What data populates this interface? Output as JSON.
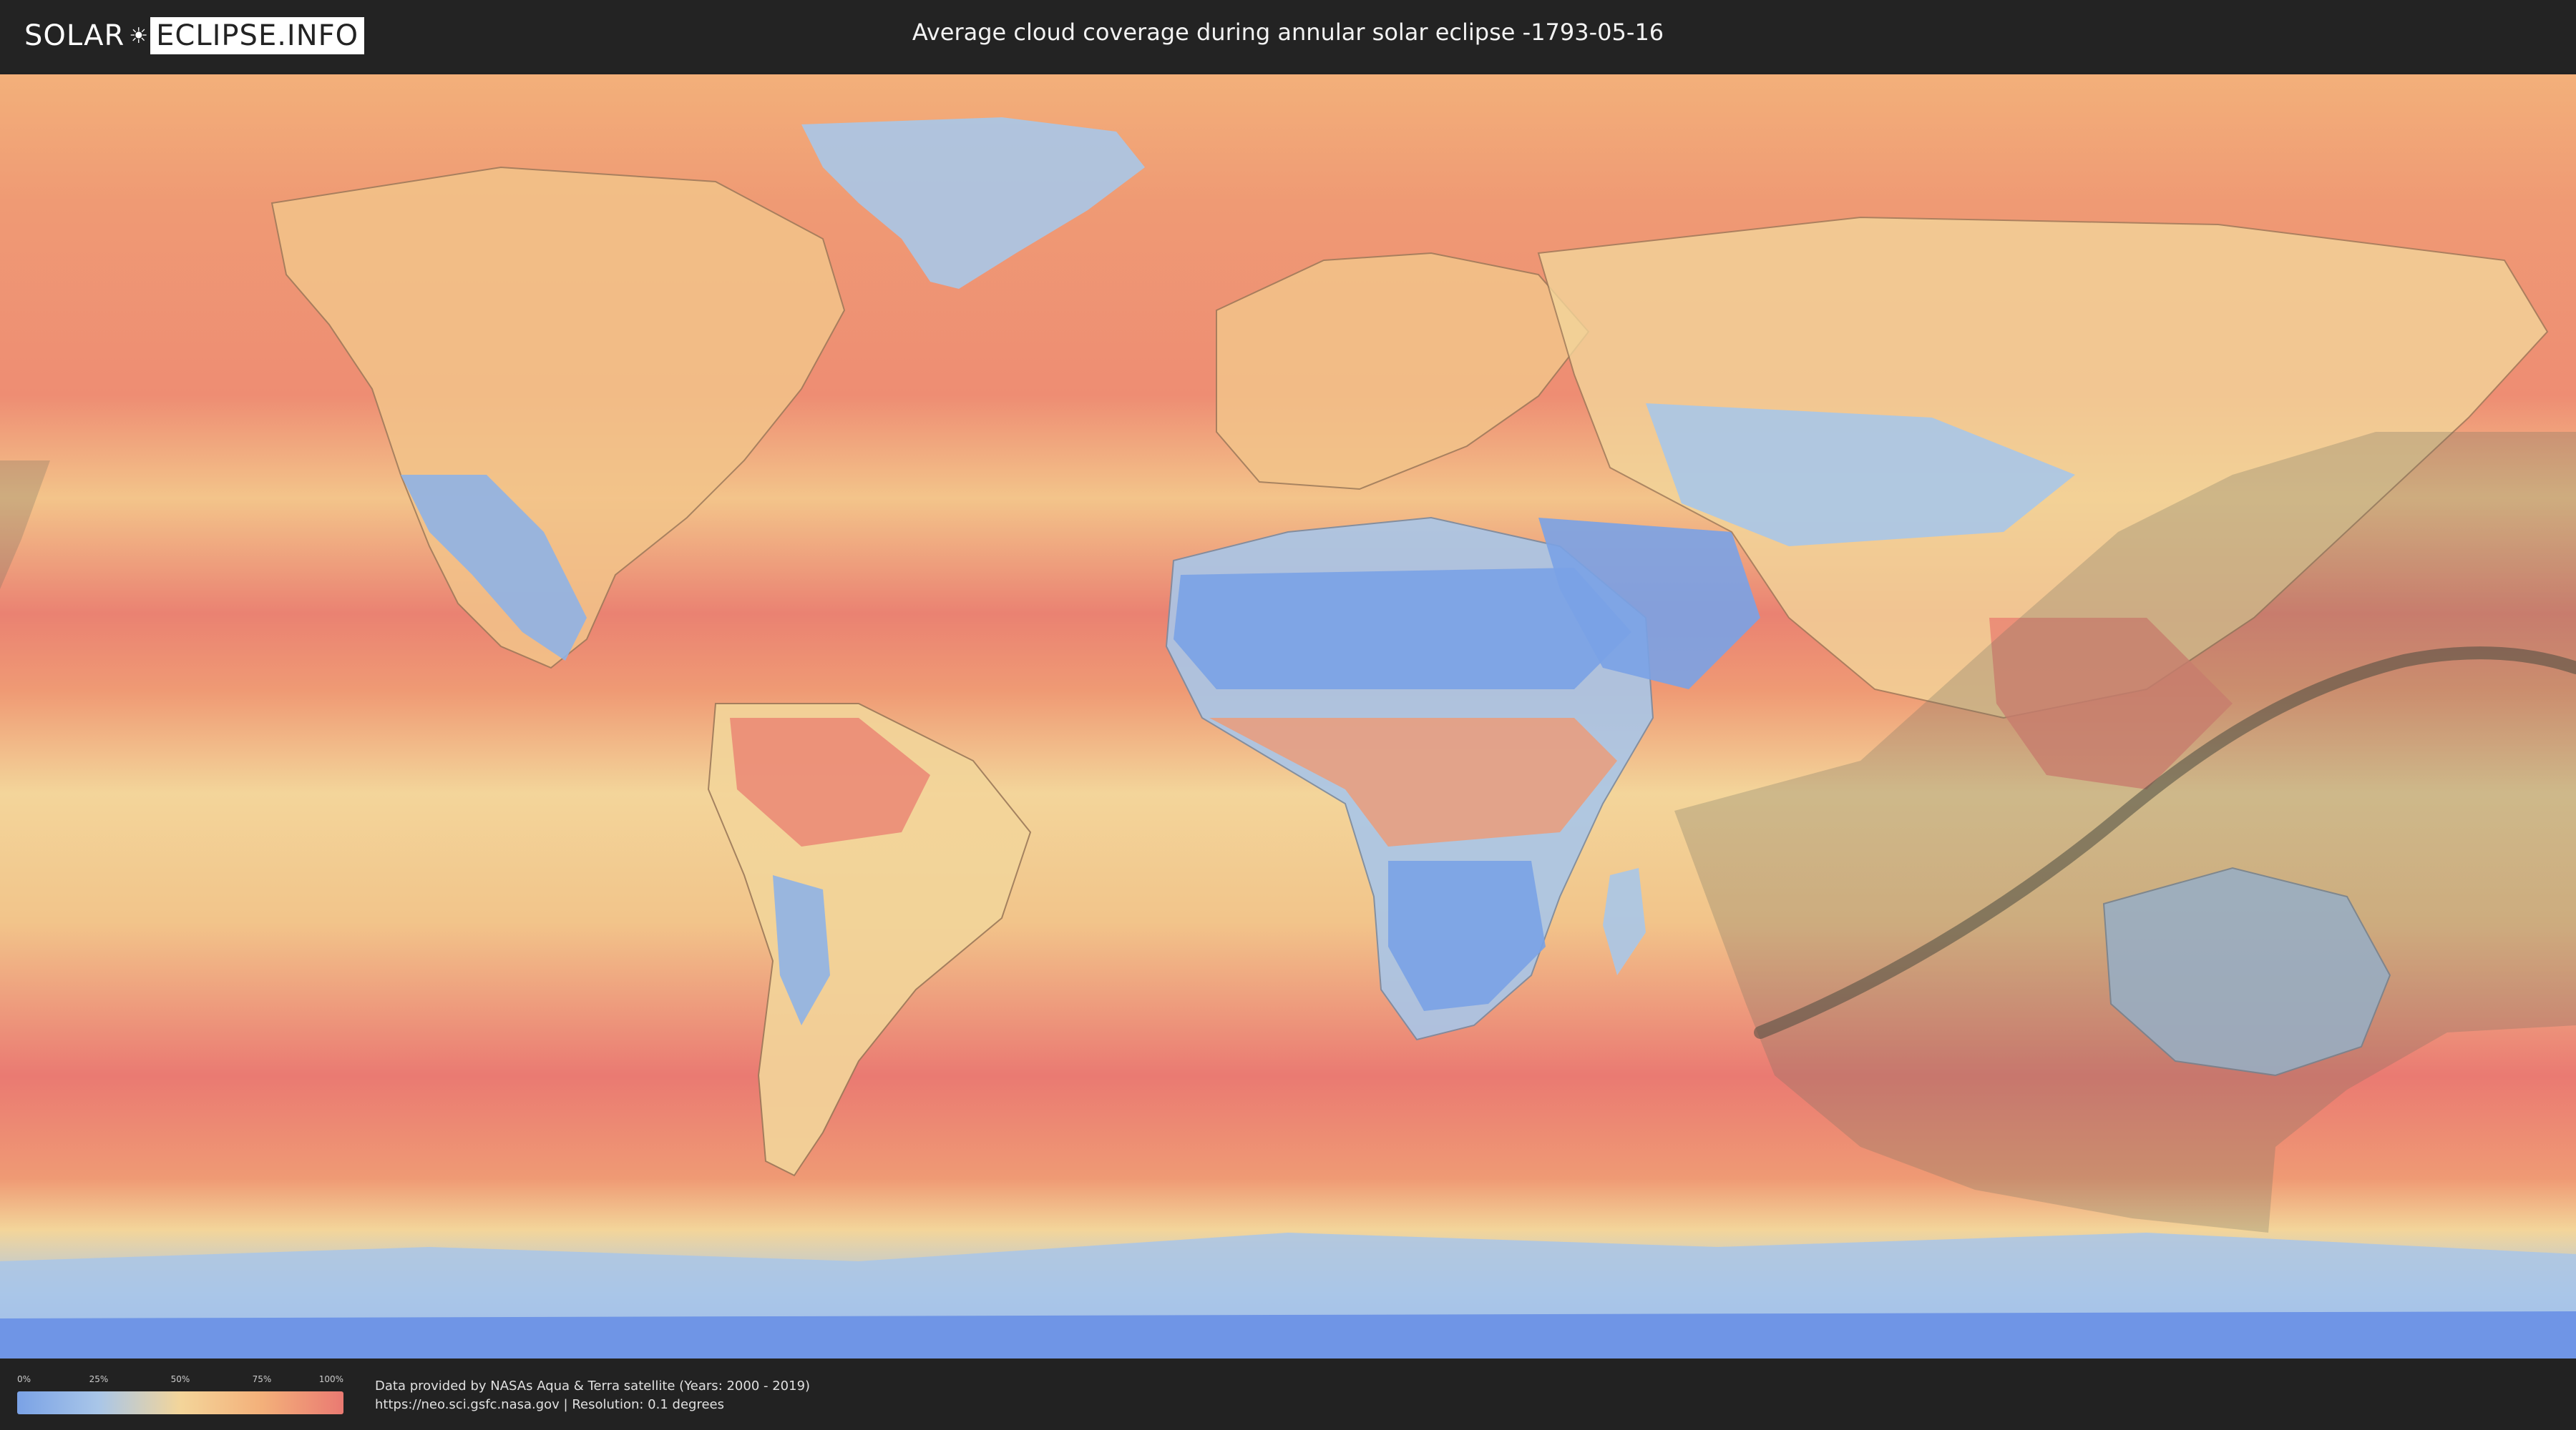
{
  "header": {
    "logo_left": "SOLAR",
    "logo_right": "ECLIPSE.INFO",
    "title": "Average cloud coverage during annular solar eclipse -1793-05-16"
  },
  "map": {
    "colors": {
      "clear": "#7aa2e6",
      "low": "#a9c6e8",
      "mid": "#f3d59a",
      "high": "#f3b07a",
      "full": "#ea7a72",
      "eclipse_shade": "#6f6f62",
      "eclipse_path": "#4a4a40"
    }
  },
  "legend": {
    "ticks": [
      "0%",
      "25%",
      "50%",
      "75%",
      "100%"
    ],
    "gradient": [
      "#7aa2e6",
      "#a9c6e8",
      "#f3d59a",
      "#f3b07a",
      "#ea7a72"
    ]
  },
  "footer": {
    "credit_line1": "Data provided by NASAs Aqua & Terra satellite (Years: 2000 - 2019)",
    "credit_line2": "https://neo.sci.gsfc.nasa.gov | Resolution: 0.1 degrees"
  }
}
